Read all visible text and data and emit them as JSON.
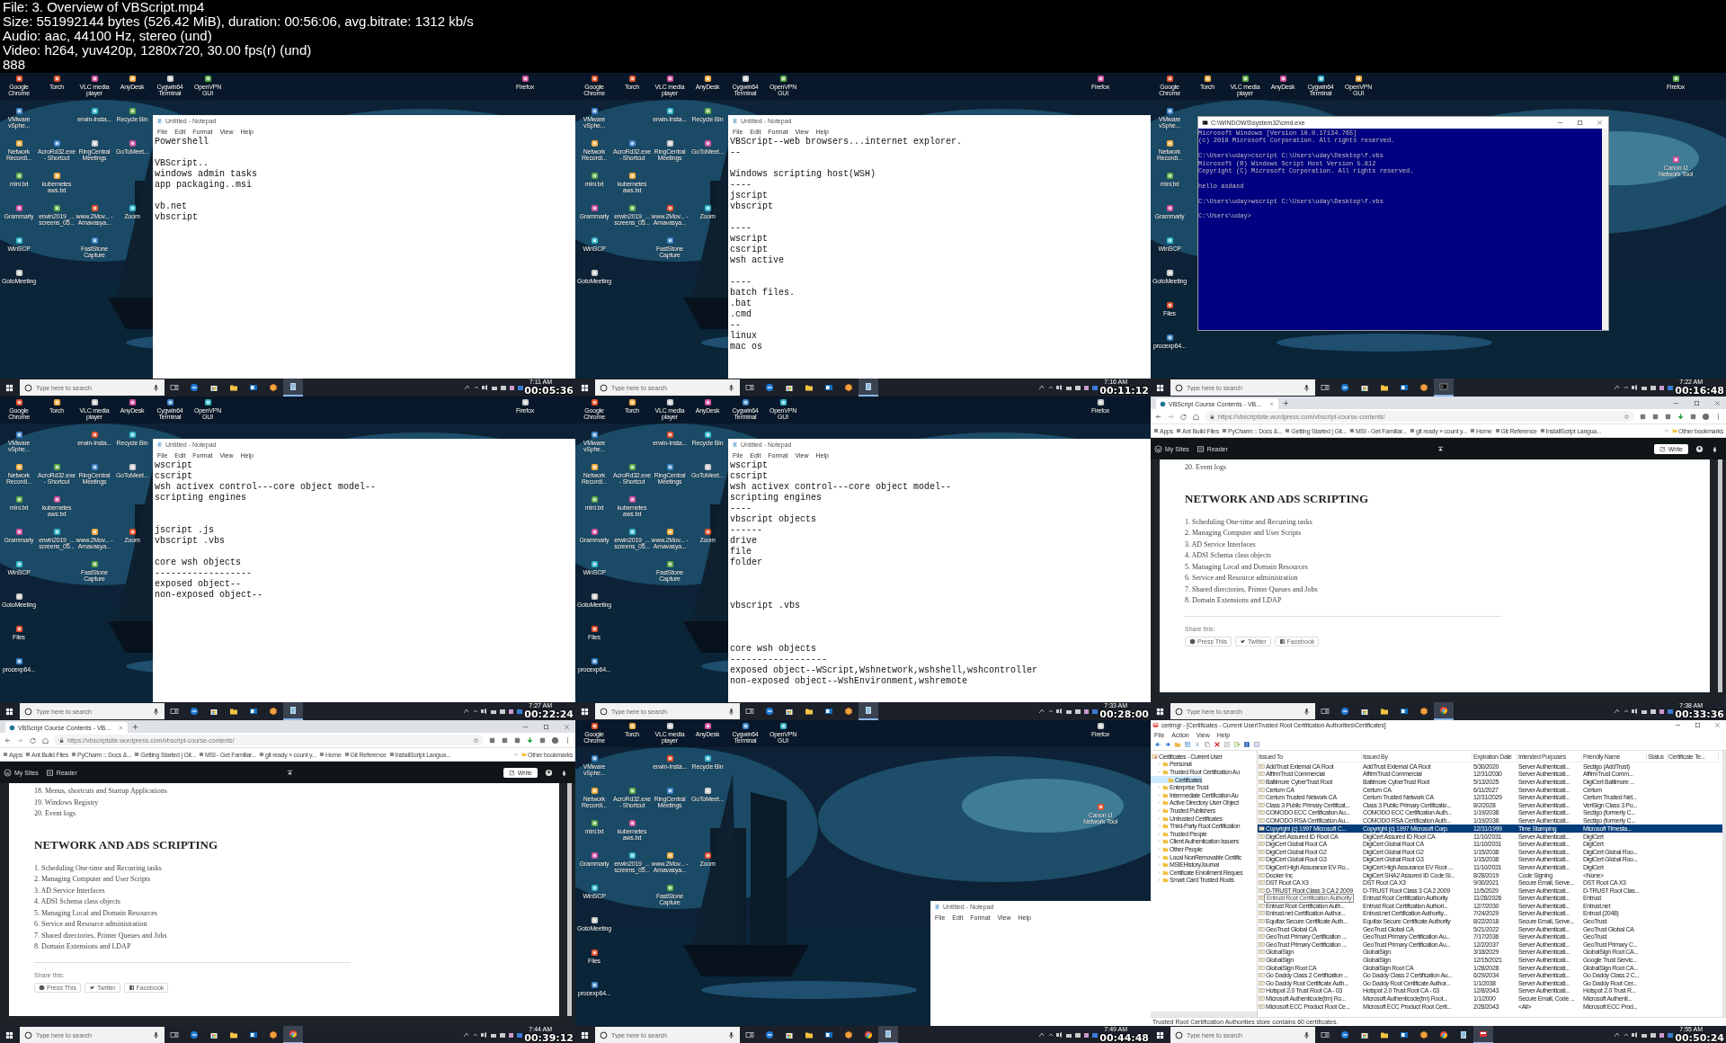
{
  "header": {
    "lines": [
      "File: 3. Overview of VBScript.mp4",
      "Size: 551992144 bytes (526.42 MiB), duration: 00:56:06, avg.bitrate: 1312 kb/s",
      "Audio: aac, 44100 Hz, stereo (und)",
      "Video: h264, yuv420p, 1280x720, 30.00 fps(r) (und)",
      "888"
    ]
  },
  "tiles": [
    {
      "kind": "notepad",
      "timestamp": "00:05:36",
      "desktop": {
        "columns": [
          [
            [
              "Google Chrome",
              "VMware vSphe...",
              "Network Recordi...",
              "mini.txt",
              "Grammarly",
              "WinSCP",
              "GotoMeeting"
            ]
          ],
          [
            [
              "Torch"
            ],
            [
              "AcroRd32.exe - Shortcut",
              "kubernetes aws.txt",
              "erwin2019_... screens_05..."
            ]
          ],
          [
            [
              "VLC media player",
              "erwin-Insta...",
              "RingCentral Meetings"
            ],
            [
              "www.2Mov... - Amavasya...",
              "FastStone Capture"
            ]
          ],
          [
            [
              "AnyDesk",
              "Recycle Bin",
              "GoToMeet..."
            ],
            [
              "Zoom"
            ]
          ],
          [
            [
              "Cygwin64 Terminal"
            ]
          ]
        ],
        "extra_icons": [
          "OpenVPN GUI",
          "Firefox"
        ]
      },
      "window": {
        "title": "Untitled - Notepad",
        "menu": [
          "File",
          "Edit",
          "Format",
          "View",
          "Help"
        ],
        "text": "Powershell\n\nVBScript..\nwindows admin tasks\napp packaging..msi\n\nvb.net\nvbscript"
      },
      "taskbar": {
        "search_placeholder": "Type here to search",
        "clock": "7:11 AM",
        "apps": [
          {
            "kind": "taskview",
            "active": false
          },
          {
            "kind": "edge",
            "active": false
          },
          {
            "kind": "store",
            "active": false
          },
          {
            "kind": "explorer",
            "active": false
          },
          {
            "kind": "outlook",
            "active": false
          },
          {
            "kind": "hexagon",
            "active": false
          },
          {
            "kind": "notepad",
            "active": true
          }
        ]
      }
    },
    {
      "kind": "notepad",
      "timestamp": "00:11:12",
      "desktop": {
        "columns": [
          [
            [
              "Google Chrome",
              "VMware vSphe...",
              "Network Recordi...",
              "mini.txt",
              "Grammarly",
              "WinSCP",
              "GotoMeeting"
            ]
          ],
          [
            [
              "Torch"
            ],
            [
              "AcroRd32.exe - Shortcut",
              "kubernetes aws.txt",
              "erwin2019_... screens_05..."
            ]
          ],
          [
            [
              "VLC media player",
              "erwin-Insta...",
              "RingCentral Meetings"
            ],
            [
              "www.2Mov... - Amavasya...",
              "FastStone Capture"
            ]
          ],
          [
            [
              "AnyDesk",
              "Recycle Bin",
              "GoToMeet..."
            ],
            [
              "Zoom"
            ]
          ],
          [
            [
              "Cygwin64 Terminal"
            ]
          ]
        ],
        "extra_icons": [
          "OpenVPN GUI",
          "Firefox"
        ]
      },
      "window": {
        "title": "Untitled - Notepad",
        "menu": [
          "File",
          "Edit",
          "Format",
          "View",
          "Help"
        ],
        "text": "VBScript--web browsers...internet explorer.\n--\n\nWindows scripting host(WSH)\n----\njscript\nvbscript\n\n----\nwscript\ncscript\nwsh active\n\n----\nbatch files.\n.bat\n.cmd\n--\nlinux\nmac os"
      },
      "taskbar": {
        "search_placeholder": "Type here to search",
        "clock": "7:16 AM",
        "apps": [
          {
            "kind": "taskview",
            "active": false
          },
          {
            "kind": "edge",
            "active": false
          },
          {
            "kind": "store",
            "active": false
          },
          {
            "kind": "explorer",
            "active": false
          },
          {
            "kind": "outlook",
            "active": false
          },
          {
            "kind": "hexagon",
            "active": false
          },
          {
            "kind": "notepad",
            "active": true
          }
        ]
      }
    },
    {
      "kind": "cmd",
      "timestamp": "00:16:48",
      "desktop": {
        "columns": [
          [
            [
              "Google Chrome",
              "VMware vSphe...",
              "Network Recordi...",
              "mini.txt",
              "Grammarly",
              "WinSCP",
              "GotoMeeting",
              "Files",
              "procexp64..."
            ]
          ],
          [
            [
              "Torch"
            ]
          ],
          [
            [
              "VLC media player"
            ]
          ],
          [
            [
              "AnyDesk"
            ]
          ],
          [
            [
              "Cygwin64 Terminal"
            ]
          ]
        ],
        "extra_icons": [
          "OpenVPN GUI",
          "Firefox",
          "Canon IJ Network Tool"
        ]
      },
      "window": {
        "title": "C:\\WINDOWS\\system32\\cmd.exe",
        "text": "Microsoft Windows [Version 10.0.17134.765]\n(c) 2018 Microsoft Corporation. All rights reserved.\n\nC:\\Users\\uday>cscript C:\\Users\\uday\\Desktop\\f.vbs\nMicrosoft (R) Windows Script Host Version 5.812\nCopyright (C) Microsoft Corporation. All rights reserved.\n\nhello asdasd\n\nC:\\Users\\uday>wscript C:\\Users\\uday\\Desktop\\f.vbs\n\nC:\\Users\\uday>"
      },
      "taskbar": {
        "search_placeholder": "Type here to search",
        "clock": "7:22 AM",
        "apps": [
          {
            "kind": "taskview",
            "active": false
          },
          {
            "kind": "edge",
            "active": false
          },
          {
            "kind": "store",
            "active": false
          },
          {
            "kind": "explorer",
            "active": false
          },
          {
            "kind": "outlook",
            "active": false
          },
          {
            "kind": "hexagon",
            "active": false
          },
          {
            "kind": "cmd",
            "active": true
          }
        ]
      }
    },
    {
      "kind": "notepad",
      "timestamp": "00:22:24",
      "desktop": {
        "columns": [
          [
            [
              "Google Chrome",
              "VMware vSphe...",
              "Network Recordi...",
              "mini.txt",
              "Grammarly",
              "WinSCP",
              "GotoMeeting",
              "Files",
              "procexp64..."
            ]
          ],
          [
            [
              "Torch"
            ],
            [
              "AcroRd32.exe - Shortcut",
              "kubernetes aws.txt",
              "erwin2019_... screens_05..."
            ]
          ],
          [
            [
              "VLC media player",
              "erwin-Insta...",
              "RingCentral Meetings"
            ],
            [
              "www.2Mov... - Amavasya...",
              "FastStone Capture"
            ]
          ],
          [
            [
              "AnyDesk",
              "Recycle Bin",
              "GoToMeet..."
            ],
            [
              "Zoom"
            ]
          ],
          [
            [
              "Cygwin64 Terminal"
            ]
          ]
        ],
        "extra_icons": [
          "OpenVPN GUI",
          "Firefox"
        ]
      },
      "window": {
        "title": "Untitled - Notepad",
        "menu": [
          "File",
          "Edit",
          "Format",
          "View",
          "Help"
        ],
        "text": "wscript\ncscript\nwsh activex control---core object model--\nscripting engines\n\n\njscript .js\nvbscript .vbs\n\ncore wsh objects\n------------------\nexposed object--\nnon-exposed object--"
      },
      "taskbar": {
        "search_placeholder": "Type here to search",
        "clock": "7:27 AM",
        "apps": [
          {
            "kind": "taskview",
            "active": false
          },
          {
            "kind": "edge",
            "active": false
          },
          {
            "kind": "store",
            "active": false
          },
          {
            "kind": "explorer",
            "active": false
          },
          {
            "kind": "outlook",
            "active": false
          },
          {
            "kind": "hexagon",
            "active": false
          },
          {
            "kind": "notepad",
            "active": true
          }
        ]
      }
    },
    {
      "kind": "notepad",
      "timestamp": "00:28:00",
      "desktop": {
        "columns": [
          [
            [
              "Google Chrome",
              "VMware vSphe...",
              "Network Recordi...",
              "mini.txt",
              "Grammarly",
              "WinSCP",
              "GotoMeeting",
              "Files",
              "procexp64..."
            ]
          ],
          [
            [
              "Torch"
            ],
            [
              "AcroRd32.exe - Shortcut",
              "kubernetes aws.txt",
              "erwin2019_... screens_05..."
            ]
          ],
          [
            [
              "VLC media player",
              "erwin-Insta...",
              "RingCentral Meetings"
            ],
            [
              "www.2Mov... - Amavasya...",
              "FastStone Capture"
            ]
          ],
          [
            [
              "AnyDesk",
              "Recycle Bin",
              "GoToMeet..."
            ],
            [
              "Zoom"
            ]
          ],
          [
            [
              "Cygwin64 Terminal"
            ]
          ]
        ],
        "extra_icons": [
          "OpenVPN GUI",
          "Firefox"
        ]
      },
      "window": {
        "title": "Untitled - Notepad",
        "menu": [
          "File",
          "Edit",
          "Format",
          "View",
          "Help"
        ],
        "text": "wscript\ncscript\nwsh activex control---core object model--\nscripting engines\n----\nvbscript objects\n------\ndrive\nfile\nfolder\n\n\n\nvbscript .vbs\n\n\n\ncore wsh objects\n------------------\nexposed object--WScript,Wshnetwork,wshshell,wshcontroller\nnon-exposed object--WshEnvironment,wshremote"
      },
      "taskbar": {
        "search_placeholder": "Type here to search",
        "clock": "7:33 AM",
        "apps": [
          {
            "kind": "taskview",
            "active": false
          },
          {
            "kind": "edge",
            "active": false
          },
          {
            "kind": "store",
            "active": false
          },
          {
            "kind": "explorer",
            "active": false
          },
          {
            "kind": "outlook",
            "active": false
          },
          {
            "kind": "hexagon",
            "active": false
          },
          {
            "kind": "notepad",
            "active": true
          }
        ]
      }
    },
    {
      "kind": "browser",
      "timestamp": "00:33:36",
      "tab": "VBScript Course Contents - VB...",
      "url": "https://vbscriptsite.wordpress.com/vbscript-course-contents/",
      "bookmarks": [
        "Apps",
        "Ant Build Files",
        "PyCharm :: Docs &...",
        "Getting Started | Git...",
        "MSI - Get Familiar...",
        "git ready » count y...",
        "Home",
        "Git Reference",
        "InstallScript Langua..."
      ],
      "other_bookmarks": "Other bookmarks",
      "wp_bar": {
        "my_sites": "My Sites",
        "reader": "Reader",
        "write": "Write"
      },
      "page": {
        "before": [
          "20. Event logs"
        ],
        "heading": "NETWORK AND ADS SCRIPTING",
        "items": [
          "1. Scheduling One-time and Recurring tasks",
          "2. Managing Computer and User Scripts",
          "3. AD Service Interfaces",
          "4. ADSI Schema class objects",
          "5. Managing Local and Domain Resources",
          "6. Service and Resource administration",
          "7. Shared directories, Printer Queues and Jobs",
          "8. Domain Extensions and LDAP"
        ],
        "share_label": "Share this:",
        "share_buttons": [
          {
            "kind": "press",
            "label": "Press This"
          },
          {
            "kind": "twitter",
            "label": "Twitter"
          },
          {
            "kind": "facebook",
            "label": "Facebook"
          }
        ]
      },
      "taskbar": {
        "search_placeholder": "Type here to search",
        "clock": "7:38 AM",
        "apps": [
          {
            "kind": "taskview",
            "active": false
          },
          {
            "kind": "edge",
            "active": false
          },
          {
            "kind": "store",
            "active": false
          },
          {
            "kind": "explorer",
            "active": false
          },
          {
            "kind": "outlook",
            "active": false
          },
          {
            "kind": "hexagon",
            "active": false
          },
          {
            "kind": "chrome",
            "active": true
          }
        ]
      }
    },
    {
      "kind": "browser",
      "timestamp": "00:39:12",
      "tab": "VBScript Course Contents - VB...",
      "url": "https://vbscriptsite.wordpress.com/vbscript-course-contents/",
      "bookmarks": [
        "Apps",
        "Ant Build Files",
        "PyCharm :: Docs &...",
        "Getting Started | Git...",
        "MSI - Get Familiar...",
        "git ready » count y...",
        "Home",
        "Git Reference",
        "InstallScript Langua..."
      ],
      "other_bookmarks": "Other bookmarks",
      "wp_bar": {
        "my_sites": "My Sites",
        "reader": "Reader",
        "write": "Write"
      },
      "page": {
        "before": [
          "18. Menus, shortcuts and Startup Applications",
          "19. Windows Registry",
          "20. Event logs"
        ],
        "heading": "NETWORK AND ADS SCRIPTING",
        "items": [
          "1. Scheduling One-time and Recurring tasks",
          "2. Managing Computer and User Scripts",
          "3. AD Service Interfaces",
          "4. ADSI Schema class objects",
          "5. Managing Local and Domain Resources",
          "6. Service and Resource administration",
          "7. Shared directories, Printer Queues and Jobs",
          "8. Domain Extensions and LDAP"
        ],
        "share_label": "Share this:",
        "share_buttons": [
          {
            "kind": "press",
            "label": "Press This"
          },
          {
            "kind": "twitter",
            "label": "Twitter"
          },
          {
            "kind": "facebook",
            "label": "Facebook"
          }
        ]
      },
      "taskbar": {
        "search_placeholder": "Type here to search",
        "clock": "7:44 AM",
        "apps": [
          {
            "kind": "taskview",
            "active": false
          },
          {
            "kind": "edge",
            "active": false
          },
          {
            "kind": "store",
            "active": false
          },
          {
            "kind": "explorer",
            "active": false
          },
          {
            "kind": "outlook",
            "active": false
          },
          {
            "kind": "hexagon",
            "active": false
          },
          {
            "kind": "chrome",
            "active": true
          }
        ]
      }
    },
    {
      "kind": "desktop",
      "timestamp": "00:44:48",
      "desktop": {
        "columns": [
          [
            [
              "Google Chrome",
              "VMware vSphe...",
              "Network Recordi...",
              "mini.txt",
              "Grammarly",
              "WinSCP",
              "GotoMeeting",
              "Files",
              "procexp64..."
            ]
          ],
          [
            [
              "Torch"
            ],
            [
              "AcroRd32.exe - Shortcut",
              "kubernetes aws.txt",
              "erwin2019_... screens_05..."
            ]
          ],
          [
            [
              "VLC media player",
              "erwin-Insta...",
              "RingCentral Meetings"
            ],
            [
              "www.2Mov... - Amavasya...",
              "FastStone Capture"
            ]
          ],
          [
            [
              "AnyDesk",
              "Recycle Bin",
              "GoToMeet..."
            ],
            [
              "Zoom"
            ]
          ],
          [
            [
              "Cygwin64 Terminal"
            ]
          ]
        ],
        "extra_icons": [
          "OpenVPN GUI",
          "Firefox",
          "Canon IJ Network Tool"
        ]
      },
      "window": {
        "title": "Untitled - Notepad",
        "menu": [
          "File",
          "Edit",
          "Format",
          "View",
          "Help"
        ]
      },
      "taskbar": {
        "search_placeholder": "Type here to search",
        "clock": "7:49 AM",
        "apps": [
          {
            "kind": "taskview",
            "active": false
          },
          {
            "kind": "edge",
            "active": false
          },
          {
            "kind": "store",
            "active": false
          },
          {
            "kind": "explorer",
            "active": false
          },
          {
            "kind": "outlook",
            "active": false
          },
          {
            "kind": "hexagon",
            "active": false
          },
          {
            "kind": "chrome",
            "active": false
          },
          {
            "kind": "notepad",
            "active": true
          }
        ]
      }
    },
    {
      "kind": "certmgr",
      "timestamp": "00:50:24",
      "window": {
        "title": "certmgr - [Certificates - Current User\\Trusted Root Certification Authorities\\Certificates]",
        "menu": [
          "File",
          "Action",
          "View",
          "Help"
        ],
        "tree": {
          "label": "Certificates - Current User",
          "children": [
            {
              "label": "Personal",
              "expanded": false,
              "selected": false
            },
            {
              "label": "Trusted Root Certification Au",
              "expanded": true,
              "selected": false,
              "children": [
                {
                  "label": "Certificates",
                  "selected": true
                }
              ]
            },
            {
              "label": "Enterprise Trust",
              "expanded": false,
              "selected": false
            },
            {
              "label": "Intermediate Certification Au",
              "expanded": false,
              "selected": false
            },
            {
              "label": "Active Directory User Object",
              "expanded": false,
              "selected": false
            },
            {
              "label": "Trusted Publishers",
              "expanded": false,
              "selected": false
            },
            {
              "label": "Untrusted Certificates",
              "expanded": false,
              "selected": false
            },
            {
              "label": "Third-Party Root Certification",
              "expanded": false,
              "selected": false
            },
            {
              "label": "Trusted People",
              "expanded": false,
              "selected": false
            },
            {
              "label": "Client Authentication Issuers",
              "expanded": false,
              "selected": false
            },
            {
              "label": "Other People",
              "expanded": false,
              "selected": false
            },
            {
              "label": "Local NonRemovable Certific",
              "expanded": false,
              "selected": false
            },
            {
              "label": "MSIEHistoryJournal",
              "expanded": false,
              "selected": false
            },
            {
              "label": "Certificate Enrollment Reques",
              "expanded": false,
              "selected": false
            },
            {
              "label": "Smart Card Trusted Roots",
              "expanded": false,
              "selected": false
            }
          ]
        },
        "columns": [
          "Issued To",
          "Issued By",
          "Expiration Date",
          "Intended Purposes",
          "Friendly Name",
          "Status",
          "Certificate Te..."
        ],
        "rows": [
          {
            "issued_to": "AddTrust External CA Root",
            "issued_by": "AddTrust External CA Root",
            "expiration": "5/30/2020",
            "purposes": "Server Authenticati...",
            "friendly_name": "Sectigo (AddTrust)",
            "selected": false
          },
          {
            "issued_to": "AffirmTrust Commercial",
            "issued_by": "AffirmTrust Commercial",
            "expiration": "12/31/2030",
            "purposes": "Server Authenticati...",
            "friendly_name": "AffirmTrust Comm...",
            "selected": false
          },
          {
            "issued_to": "Baltimore CyberTrust Root",
            "issued_by": "Baltimore CyberTrust Root",
            "expiration": "5/13/2025",
            "purposes": "Server Authenticati...",
            "friendly_name": "DigiCert Baltimore ...",
            "selected": false
          },
          {
            "issued_to": "Certum CA",
            "issued_by": "Certum CA",
            "expiration": "6/11/2027",
            "purposes": "Server Authenticati...",
            "friendly_name": "Certum",
            "selected": false
          },
          {
            "issued_to": "Certum Trusted Network CA",
            "issued_by": "Certum Trusted Network CA",
            "expiration": "12/31/2029",
            "purposes": "Server Authenticati...",
            "friendly_name": "Certum Trusted Net...",
            "selected": false
          },
          {
            "issued_to": "Class 3 Public Primary Certificat...",
            "issued_by": "Class 3 Public Primary Certificatio...",
            "expiration": "8/2/2028",
            "purposes": "Server Authenticati...",
            "friendly_name": "VeriSign Class 3 Pu...",
            "selected": false
          },
          {
            "issued_to": "COMODO ECC Certification Au...",
            "issued_by": "COMODO ECC Certification Auth...",
            "expiration": "1/19/2038",
            "purposes": "Server Authenticati...",
            "friendly_name": "Sectigo (formerly C...",
            "selected": false
          },
          {
            "issued_to": "COMODO RSA Certification Au...",
            "issued_by": "COMODO RSA Certification Auth...",
            "expiration": "1/19/2038",
            "purposes": "Server Authenticati...",
            "friendly_name": "Sectigo (formerly C...",
            "selected": false
          },
          {
            "issued_to": "Copyright (c) 1997 Microsoft C...",
            "issued_by": "Copyright (c) 1997 Microsoft Corp.",
            "expiration": "12/31/1999",
            "purposes": "Time Stamping",
            "friendly_name": "Microsoft Timesta...",
            "selected": true
          },
          {
            "issued_to": "DigiCert Assured ID Root CA",
            "issued_by": "DigiCert Assured ID Root CA",
            "expiration": "11/10/2031",
            "purposes": "Server Authenticati...",
            "friendly_name": "DigiCert",
            "selected": false
          },
          {
            "issued_to": "DigiCert Global Root CA",
            "issued_by": "DigiCert Global Root CA",
            "expiration": "11/10/2031",
            "purposes": "Server Authenticati...",
            "friendly_name": "DigiCert",
            "selected": false
          },
          {
            "issued_to": "DigiCert Global Root G2",
            "issued_by": "DigiCert Global Root G2",
            "expiration": "1/15/2038",
            "purposes": "Server Authenticati...",
            "friendly_name": "DigiCert Global Roo...",
            "selected": false
          },
          {
            "issued_to": "DigiCert Global Root G3",
            "issued_by": "DigiCert Global Root G3",
            "expiration": "1/15/2038",
            "purposes": "Server Authenticati...",
            "friendly_name": "DigiCert Global Roo...",
            "selected": false
          },
          {
            "issued_to": "DigiCert High Assurance EV Ro...",
            "issued_by": "DigiCert High Assurance EV Root ...",
            "expiration": "11/10/2031",
            "purposes": "Server Authenticati...",
            "friendly_name": "DigiCert",
            "selected": false
          },
          {
            "issued_to": "Docker Inc",
            "issued_by": "DigiCert SHA2 Assured ID Code Si...",
            "expiration": "8/28/2019",
            "purposes": "Code Signing",
            "friendly_name": "<None>",
            "selected": false
          },
          {
            "issued_to": "DST Root CA X3",
            "issued_by": "DST Root CA X3",
            "expiration": "9/30/2021",
            "purposes": "Secure Email, Serve...",
            "friendly_name": "DST Root CA X3",
            "selected": false
          },
          {
            "issued_to": "D-TRUST Root Class 3 CA 2 2009",
            "issued_by": "D-TRUST Root Class 3 CA 2 2009",
            "expiration": "11/5/2029",
            "purposes": "Server Authenticati...",
            "friendly_name": "D-TRUST Root Clas...",
            "selected": false
          },
          {
            "tooltip": "Entrust Root Certification Authority",
            "issued_by": "Entrust Root Certification Authority",
            "expiration": "11/28/2026",
            "purposes": "Server Authenticati...",
            "friendly_name": "Entrust",
            "selected": false
          },
          {
            "issued_to": "Entrust Root Certification Auth...",
            "issued_by": "Entrust Root Certification Authori...",
            "expiration": "12/7/2030",
            "purposes": "Server Authenticati...",
            "friendly_name": "Entrust.net",
            "selected": false
          },
          {
            "issued_to": "Entrust.net Certification Author...",
            "issued_by": "Entrust.net Certification Authority...",
            "expiration": "7/24/2029",
            "purposes": "Server Authenticati...",
            "friendly_name": "Entrust (2048)",
            "selected": false
          },
          {
            "issued_to": "Equifax Secure Certificate Auth...",
            "issued_by": "Equifax Secure Certificate Authority",
            "expiration": "8/22/2018",
            "purposes": "Secure Email, Serve...",
            "friendly_name": "GeoTrust",
            "selected": false
          },
          {
            "issued_to": "GeoTrust Global CA",
            "issued_by": "GeoTrust Global CA",
            "expiration": "5/21/2022",
            "purposes": "Server Authenticati...",
            "friendly_name": "GeoTrust Global CA",
            "selected": false
          },
          {
            "issued_to": "GeoTrust Primary Certification ...",
            "issued_by": "GeoTrust Primary Certification Au...",
            "expiration": "7/17/2036",
            "purposes": "Server Authenticati...",
            "friendly_name": "GeoTrust",
            "selected": false
          },
          {
            "issued_to": "GeoTrust Primary Certification ...",
            "issued_by": "GeoTrust Primary Certification Au...",
            "expiration": "12/2/2037",
            "purposes": "Server Authenticati...",
            "friendly_name": "GeoTrust Primary C...",
            "selected": false
          },
          {
            "issued_to": "GlobalSign",
            "issued_by": "GlobalSign",
            "expiration": "3/18/2029",
            "purposes": "Server Authenticati...",
            "friendly_name": "GlobalSign Root CA...",
            "selected": false
          },
          {
            "issued_to": "GlobalSign",
            "issued_by": "GlobalSign",
            "expiration": "12/15/2021",
            "purposes": "Server Authenticati...",
            "friendly_name": "Google Trust Servic...",
            "selected": false
          },
          {
            "issued_to": "GlobalSign Root CA",
            "issued_by": "GlobalSign Root CA",
            "expiration": "1/28/2028",
            "purposes": "Server Authenticati...",
            "friendly_name": "GlobalSign Root CA...",
            "selected": false
          },
          {
            "issued_to": "Go Daddy Class 2 Certification ...",
            "issued_by": "Go Daddy Class 2 Certification Au...",
            "expiration": "6/29/2034",
            "purposes": "Server Authenticati...",
            "friendly_name": "Go Daddy Class 2 C...",
            "selected": false
          },
          {
            "issued_to": "Go Daddy Root Certificate Auth...",
            "issued_by": "Go Daddy Root Certificate Author...",
            "expiration": "1/1/2038",
            "purposes": "Server Authenticati...",
            "friendly_name": "Go Daddy Root Cer...",
            "selected": false
          },
          {
            "issued_to": "Hotspot 2.0 Trust Root CA - 03",
            "issued_by": "Hotspot 2.0 Trust Root CA - 03",
            "expiration": "12/8/2043",
            "purposes": "Server Authenticati...",
            "friendly_name": "Hotspot 2.0 Trust R...",
            "selected": false
          },
          {
            "issued_to": "Microsoft Authenticode(tm) Ro...",
            "issued_by": "Microsoft Authenticode(tm) Root...",
            "expiration": "1/1/2000",
            "purposes": "Secure Email, Code ...",
            "friendly_name": "Microsoft Authenti...",
            "selected": false
          },
          {
            "issued_to": "Microsoft ECC Product Root Ce...",
            "issued_by": "Microsoft ECC Product Root Certi...",
            "expiration": "2/28/2043",
            "purposes": "<All>",
            "friendly_name": "Microsoft ECC Prod...",
            "selected": false
          }
        ],
        "status": "Trusted Root Certification Authorities store contains 60 certificates."
      },
      "taskbar": {
        "search_placeholder": "Type here to search",
        "clock": "7:55 AM",
        "apps": [
          {
            "kind": "taskview",
            "active": false
          },
          {
            "kind": "edge",
            "active": false
          },
          {
            "kind": "store",
            "active": false
          },
          {
            "kind": "explorer",
            "active": false
          },
          {
            "kind": "outlook",
            "active": false
          },
          {
            "kind": "hexagon",
            "active": false
          },
          {
            "kind": "chrome",
            "active": false
          },
          {
            "kind": "notepad",
            "active": false
          },
          {
            "kind": "certmgr",
            "active": true
          }
        ]
      }
    }
  ]
}
